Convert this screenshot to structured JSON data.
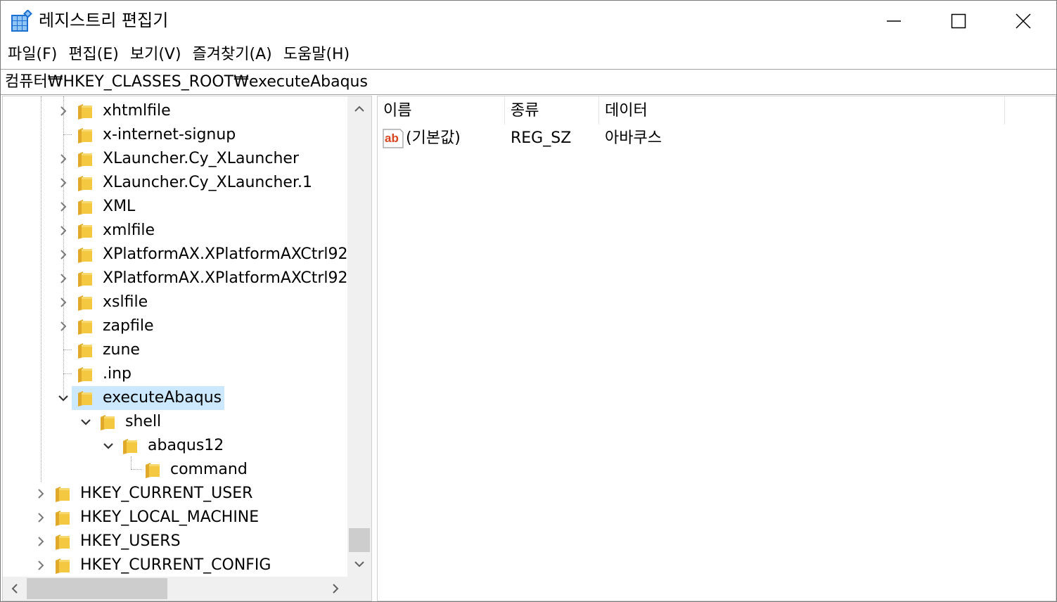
{
  "window": {
    "title": "레지스트리 편집기",
    "controls": {
      "minimize": "minimize-icon",
      "maximize": "maximize-icon",
      "close": "close-icon"
    }
  },
  "menu": [
    "파일(F)",
    "편집(E)",
    "보기(V)",
    "즐겨찾기(A)",
    "도움말(H)"
  ],
  "address": "컴퓨터₩HKEY_CLASSES_ROOT₩executeAbaqus",
  "tree": {
    "items": [
      {
        "label": "xhtmlfile",
        "expander": "collapsed"
      },
      {
        "label": "x-internet-signup",
        "expander": "none"
      },
      {
        "label": "XLauncher.Cy_XLauncher",
        "expander": "collapsed"
      },
      {
        "label": "XLauncher.Cy_XLauncher.1",
        "expander": "collapsed"
      },
      {
        "label": "XML",
        "expander": "collapsed"
      },
      {
        "label": "xmlfile",
        "expander": "collapsed"
      },
      {
        "label": "XPlatformAX.XPlatformAXCtrl92",
        "expander": "collapsed"
      },
      {
        "label": "XPlatformAX.XPlatformAXCtrl92.1",
        "expander": "collapsed"
      },
      {
        "label": "xslfile",
        "expander": "collapsed"
      },
      {
        "label": "zapfile",
        "expander": "collapsed"
      },
      {
        "label": "zune",
        "expander": "none"
      },
      {
        "label": ".inp",
        "expander": "none"
      },
      {
        "label": "executeAbaqus",
        "expander": "expanded",
        "selected": true
      },
      {
        "label": "shell",
        "expander": "expanded"
      },
      {
        "label": "abaqus12",
        "expander": "expanded"
      },
      {
        "label": "command",
        "expander": "none"
      },
      {
        "label": "HKEY_CURRENT_USER",
        "expander": "collapsed"
      },
      {
        "label": "HKEY_LOCAL_MACHINE",
        "expander": "collapsed"
      },
      {
        "label": "HKEY_USERS",
        "expander": "collapsed"
      },
      {
        "label": "HKEY_CURRENT_CONFIG",
        "expander": "collapsed"
      }
    ]
  },
  "list": {
    "columns": [
      "이름",
      "종류",
      "데이터"
    ],
    "rows": [
      {
        "name": "(기본값)",
        "type": "REG_SZ",
        "data": "아바쿠스",
        "icon": "string-value-icon"
      }
    ]
  },
  "colors": {
    "selection": "#cce8ff",
    "folder": "#f5c842",
    "scrollbar_track": "#f0f0f0",
    "scrollbar_thumb": "#cdcdcd",
    "app_icon": "#1c6fd1"
  }
}
